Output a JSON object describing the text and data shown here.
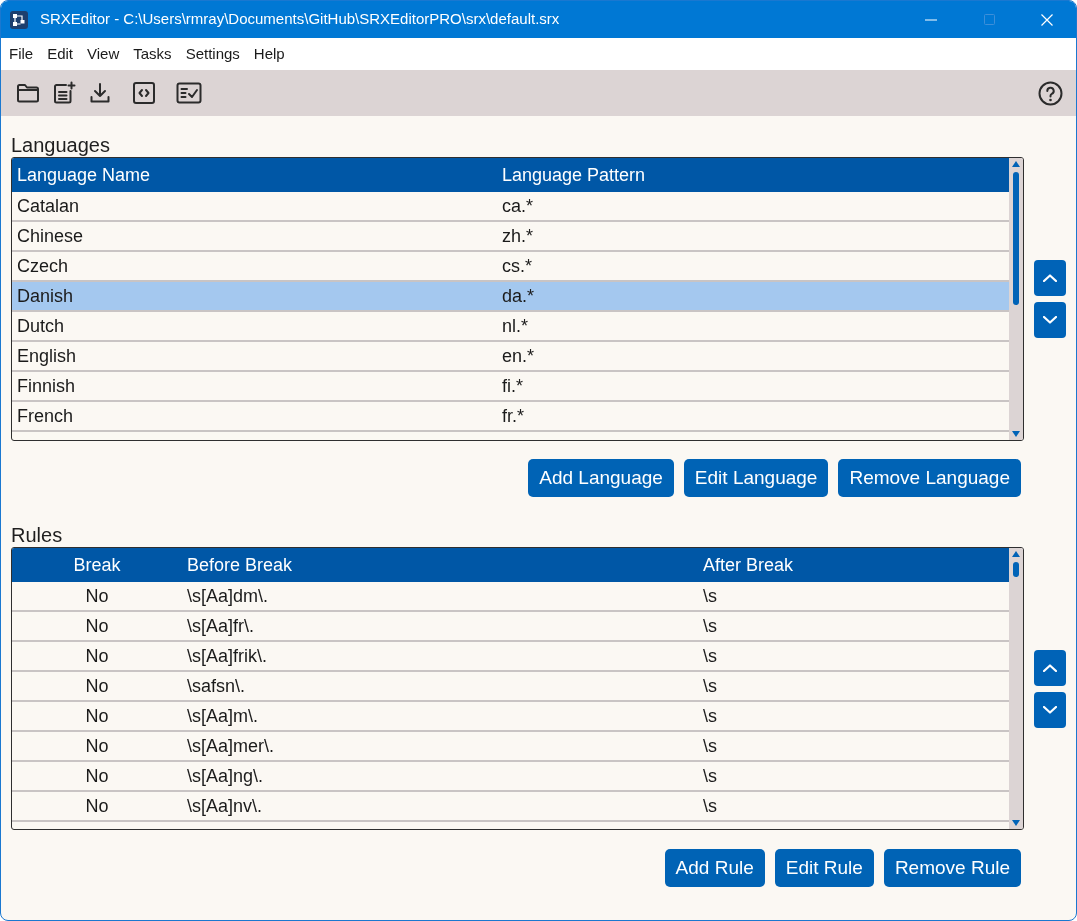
{
  "window": {
    "title": "SRXEditor - C:\\Users\\rmray\\Documents\\GitHub\\SRXEditorPRO\\srx\\default.srx",
    "maximize_disabled": true
  },
  "menu": [
    "File",
    "Edit",
    "View",
    "Tasks",
    "Settings",
    "Help"
  ],
  "languages": {
    "title": "Languages",
    "columns": [
      "Language Name",
      "Language Pattern"
    ],
    "rows": [
      {
        "name": "Catalan",
        "pattern": "ca.*",
        "selected": false
      },
      {
        "name": "Chinese",
        "pattern": "zh.*",
        "selected": false
      },
      {
        "name": "Czech",
        "pattern": "cs.*",
        "selected": false
      },
      {
        "name": "Danish",
        "pattern": "da.*",
        "selected": true
      },
      {
        "name": "Dutch",
        "pattern": "nl.*",
        "selected": false
      },
      {
        "name": "English",
        "pattern": "en.*",
        "selected": false
      },
      {
        "name": "Finnish",
        "pattern": "fi.*",
        "selected": false
      },
      {
        "name": "French",
        "pattern": "fr.*",
        "selected": false
      }
    ],
    "buttons": [
      "Add Language",
      "Edit Language",
      "Remove Language"
    ]
  },
  "rules": {
    "title": "Rules",
    "columns": [
      "Break",
      "Before Break",
      "After Break"
    ],
    "rows": [
      {
        "break": "No",
        "before": "\\s[Aa]dm\\.",
        "after": "\\s",
        "selected": false
      },
      {
        "break": "No",
        "before": "\\s[Aa]fr\\.",
        "after": "\\s",
        "selected": false
      },
      {
        "break": "No",
        "before": "\\s[Aa]frik\\.",
        "after": "\\s",
        "selected": false
      },
      {
        "break": "No",
        "before": "\\safsn\\.",
        "after": "\\s",
        "selected": false
      },
      {
        "break": "No",
        "before": "\\s[Aa]m\\.",
        "after": "\\s",
        "selected": false
      },
      {
        "break": "No",
        "before": "\\s[Aa]mer\\.",
        "after": "\\s",
        "selected": false
      },
      {
        "break": "No",
        "before": "\\s[Aa]ng\\.",
        "after": "\\s",
        "selected": false
      },
      {
        "break": "No",
        "before": "\\s[Aa]nv\\.",
        "after": "\\s",
        "selected": false
      }
    ],
    "buttons": [
      "Add Rule",
      "Edit Rule",
      "Remove Rule"
    ]
  }
}
